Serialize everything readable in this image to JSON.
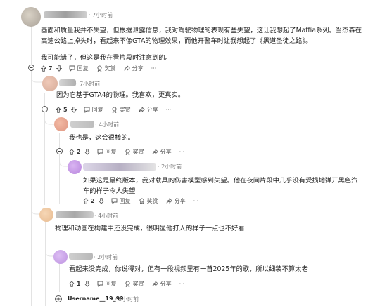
{
  "comments": [
    {
      "time": "· 7小时前",
      "lines": [
        "画面和质量我并不失望，但根据泄露信息，我对驾驶物理的表现有些失望，这让我想起了Maffia系列。当杰森在",
        "高速公路上掉头时，看起来不像GTA的物理效果，而他开警车时让我想起了《黑道圣徒之路》。",
        "",
        "我可能错了，但这是我在看片段时注意到的。"
      ],
      "votes": "7",
      "reply": "回复",
      "award": "奖赏",
      "share": "分享",
      "more": "···"
    },
    {
      "time": "· 7小时前",
      "lines": [
        "因为它基于GTA4的物理。我喜欢，更真实。"
      ],
      "votes": "5",
      "reply": "回复",
      "award": "奖赏",
      "share": "分享",
      "more": "···"
    },
    {
      "time": "· 4小时前",
      "lines": [
        "我也是，这会很棒的。"
      ],
      "votes": "2",
      "reply": "回复",
      "award": "奖赏",
      "share": "分享",
      "more": "···"
    },
    {
      "time": "· 2小时前",
      "lines": [
        "如果这是最终版本，我对载具的伤害模型感到失望。他在夜间片段中几乎没有受损地弹开黑色汽",
        "车的样子令人失望"
      ],
      "votes": "2",
      "reply": "回复",
      "award": "奖赏",
      "share": "分享",
      "more": "···"
    },
    {
      "time": "· 4小时前",
      "lines": [
        "物理和动画在构建中还没完成，很明显他打人的样子一点也不好看"
      ],
      "votes": "",
      "reply": "",
      "award": "",
      "share": "",
      "more": ""
    },
    {
      "time": "· 2小时前",
      "lines": [
        "看起来没完成，你说得对，但有一段视频里有一首2025年的歌，所以细装不算太老"
      ],
      "votes": "1",
      "reply": "回复",
      "award": "奖赏",
      "share": "分享",
      "more": "···"
    },
    {
      "username": "Username__19_99",
      "time": "· 3小时前"
    }
  ]
}
